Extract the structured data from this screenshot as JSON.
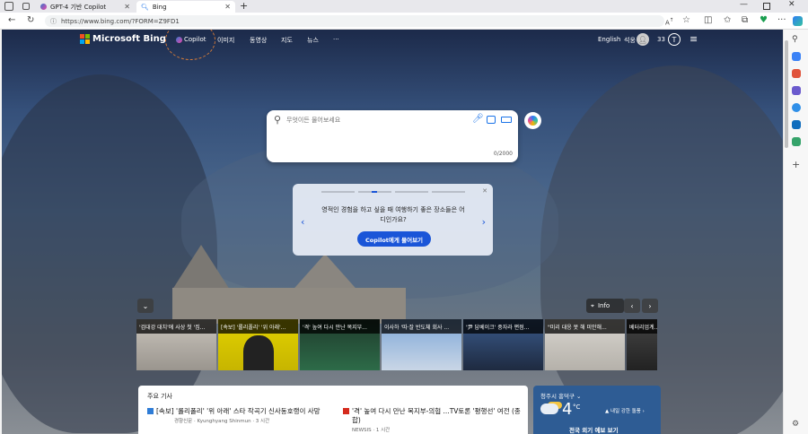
{
  "tabs": [
    {
      "title": "GPT-4 기반 Copilot"
    },
    {
      "title": "Bing"
    }
  ],
  "address": {
    "url": "https://www.bing.com/?FORM=Z9FD1"
  },
  "bing": {
    "logo_text": "Microsoft Bing",
    "nav": [
      "Copilot",
      "이미지",
      "동영상",
      "지도",
      "뉴스",
      "···"
    ],
    "lang": "English",
    "user": "석웅",
    "points": "33"
  },
  "search": {
    "placeholder": "무엇이든 물어보세요",
    "counter": "0/2000"
  },
  "prompt_card": {
    "text": "영적인 경험을 하고 싶을 때 여행하기 좋은 장소들은 어디인가요?",
    "button": "Copilot에게 물어보기"
  },
  "info_label": "Info",
  "tiles": [
    {
      "caption": "'검대강 대치'에 사상 첫 '집..."
    },
    {
      "caption": "[속보] '롤리폴리' '위 아래'..."
    },
    {
      "caption": "'격' 높여 다시 만난 복지부..."
    },
    {
      "caption": "이사하 '따·잘 반도체 회사 ..."
    },
    {
      "caption": "'尹 답베이크' 중자라 편점..."
    },
    {
      "caption": "\"미리 대응 못 해 미안해..."
    },
    {
      "caption": "베터리업계..."
    }
  ],
  "news": {
    "section_title": "주요 기사",
    "items": [
      {
        "text": "[속보] '롤리폴리' '위 아래' 스타 작곡기 신사동호랭이 사망",
        "source": "경향신문 · Kyunghyang Shinmun · 3 시간"
      },
      {
        "text": "'격' 높여 다시 만난 복지부-의협 ...TV토론 '평행선' 여전 (종합)",
        "source": "NEWSIS · 1 시간"
      }
    ]
  },
  "weather": {
    "location": "청주시 흥덕구",
    "temp": "4",
    "unit": "°C",
    "note": "내일 강한 돌풍",
    "more": "전국 외기 예보 보기"
  }
}
